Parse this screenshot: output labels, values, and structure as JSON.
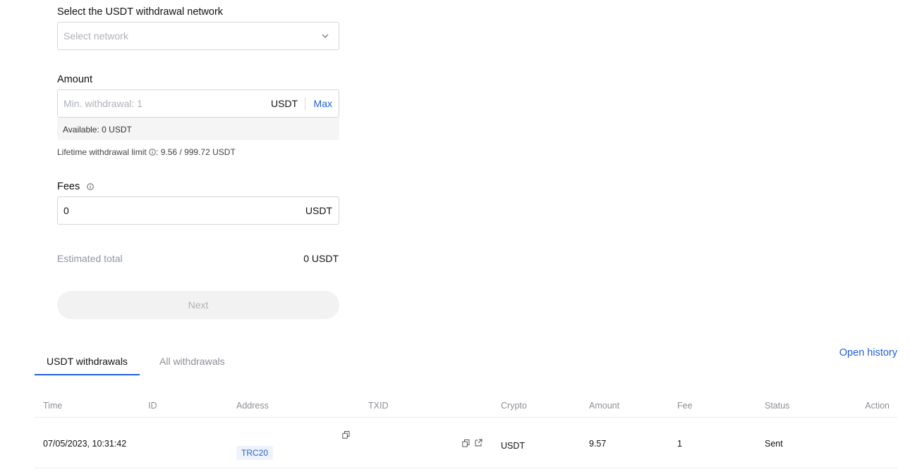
{
  "form": {
    "network_label": "Select the USDT withdrawal network",
    "network_placeholder": "Select network",
    "amount_label": "Amount",
    "amount_placeholder": "Min. withdrawal: 1",
    "amount_unit": "USDT",
    "max_label": "Max",
    "available": "Available: 0 USDT",
    "limit_label": "Lifetime withdrawal limit",
    "limit_value": ": 9.56 / 999.72 USDT",
    "fees_label": "Fees",
    "fees_value": "0",
    "fees_unit": "USDT",
    "estimated_label": "Estimated total",
    "estimated_value": "0 USDT",
    "next_label": "Next"
  },
  "tabs": [
    {
      "label": "USDT withdrawals",
      "active": true
    },
    {
      "label": "All withdrawals",
      "active": false
    }
  ],
  "open_history": "Open history",
  "table": {
    "headers": [
      "Time",
      "ID",
      "Address",
      "TXID",
      "Crypto",
      "Amount",
      "Fee",
      "Status",
      "Action"
    ],
    "rows": [
      {
        "time": "07/05/2023, 10:31:42",
        "id": "",
        "address_network": "TRC20",
        "txid": "",
        "crypto": "USDT",
        "amount": "9.57",
        "fee": "1",
        "status": "Sent"
      }
    ]
  },
  "colors": {
    "accent": "#1f5fe0",
    "muted": "#8b8f96",
    "border": "#d6d6d6"
  },
  "icons": [
    "chevron-down-icon",
    "info-icon",
    "copy-icon",
    "external-link-icon"
  ]
}
